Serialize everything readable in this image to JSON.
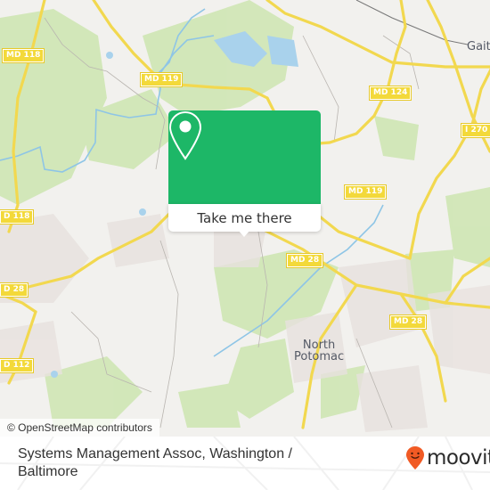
{
  "map": {
    "road_labels": [
      {
        "id": "md118-top",
        "text": "MD 118"
      },
      {
        "id": "md119-top",
        "text": "MD 119"
      },
      {
        "id": "md124",
        "text": "MD 124"
      },
      {
        "id": "i270",
        "text": "I 270"
      },
      {
        "id": "md119-mid",
        "text": "MD 119"
      },
      {
        "id": "md118-left",
        "text": "D 118"
      },
      {
        "id": "md28-center",
        "text": "MD 28"
      },
      {
        "id": "md28-left",
        "text": "D 28"
      },
      {
        "id": "md28-right",
        "text": "MD 28"
      },
      {
        "id": "md112",
        "text": "D 112"
      }
    ],
    "place_labels": {
      "north_potomac_line1": "North",
      "north_potomac_line2": "Potomac",
      "gaithersburg_partial": "Gait"
    },
    "attribution": "© OpenStreetMap contributors"
  },
  "popup": {
    "icon": "map-pin-icon",
    "button_label": "Take me there",
    "accent_color": "#1db767"
  },
  "footer": {
    "title": "Systems Management Assoc, Washington / Baltimore",
    "brand": {
      "name": "moovit",
      "icon": "moovit-pin-smile-icon",
      "color": "#f15a24"
    }
  }
}
